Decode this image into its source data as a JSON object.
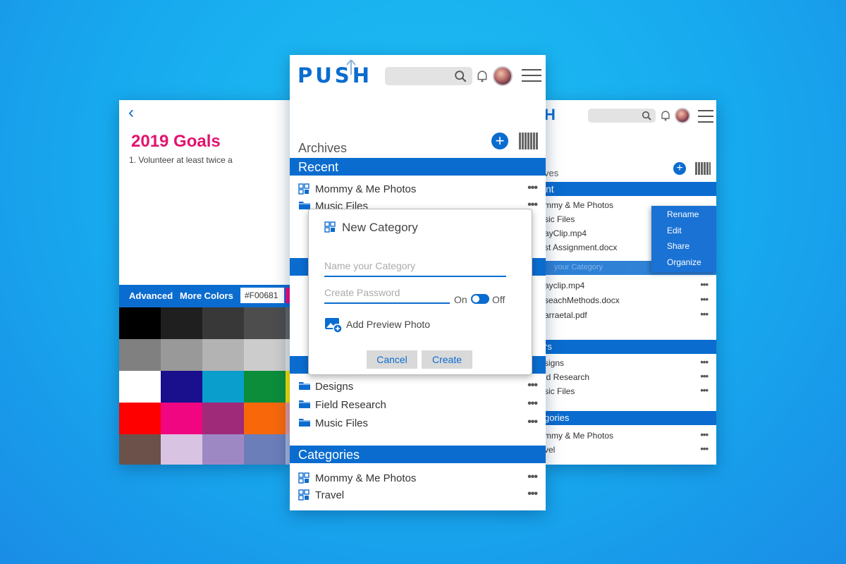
{
  "colors": {
    "brand_blue": "#0b6ccf",
    "magenta": "#e2136e",
    "bg": "#17a9ee"
  },
  "left": {
    "back_glyph": "‹",
    "title": "2019 Goals",
    "body_line": "1. Volunteer at least twice a",
    "tabs": {
      "advanced": "Advanced",
      "more_colors": "More Colors",
      "hex_value": "#F00681"
    },
    "palette": [
      [
        "#000000",
        "#1f1f1f",
        "#383838",
        "#4d4d4d",
        "#666666"
      ],
      [
        "#808080",
        "#999999",
        "#b3b3b3",
        "#cccccc",
        "#e6e6e6"
      ],
      [
        "#ffffff",
        "#1a0f8c",
        "#0a9ecd",
        "#0b8d3a",
        "#f5e400"
      ],
      [
        "#ff0000",
        "#f00681",
        "#9f2a7a",
        "#f8680b",
        "#e89a9a"
      ],
      [
        "#6b5149",
        "#d8c4e2",
        "#9e88c4",
        "#6b7eb9",
        "#a9b6d9"
      ]
    ]
  },
  "center": {
    "logo": "PUSH",
    "archives_title": "Archives",
    "recent_header": "Recent",
    "recent_items": [
      {
        "label": "Mommy & Me Photos",
        "icon": "category-icon"
      },
      {
        "label": "Music Files",
        "icon": "folder-icon"
      }
    ],
    "folders_items": [
      {
        "label": "Designs"
      },
      {
        "label": "Field Research"
      },
      {
        "label": "Music Files"
      }
    ],
    "categories_header": "Categories",
    "categories_items": [
      {
        "label": "Mommy & Me Photos"
      },
      {
        "label": "Travel"
      }
    ],
    "more_glyph": "•••"
  },
  "dialog": {
    "title": "New Category",
    "name_placeholder": "Name your Category",
    "password_placeholder": "Create Password",
    "toggle_on": "On",
    "toggle_off": "Off",
    "add_photo": "Add Preview Photo",
    "cancel": "Cancel",
    "create": "Create"
  },
  "right": {
    "archives_partial": "ves",
    "recent_partial": "nt",
    "recent_items": [
      "mmy & Me Photos",
      "sic Files",
      "ayClip.mp4",
      "st Assignment.docx"
    ],
    "overlay_text": "your Category",
    "second_items": [
      "ayclip.mp4",
      "seachMethods.docx",
      "arraetal.pdf"
    ],
    "folders_partial": "rs",
    "folder_items": [
      "signs",
      "ld Research",
      "sic Files"
    ],
    "categories_partial": "gories",
    "category_items": [
      "mmy & Me Photos",
      "vel"
    ],
    "context_menu": [
      "Rename",
      "Edit",
      "Share",
      "Organize"
    ]
  }
}
